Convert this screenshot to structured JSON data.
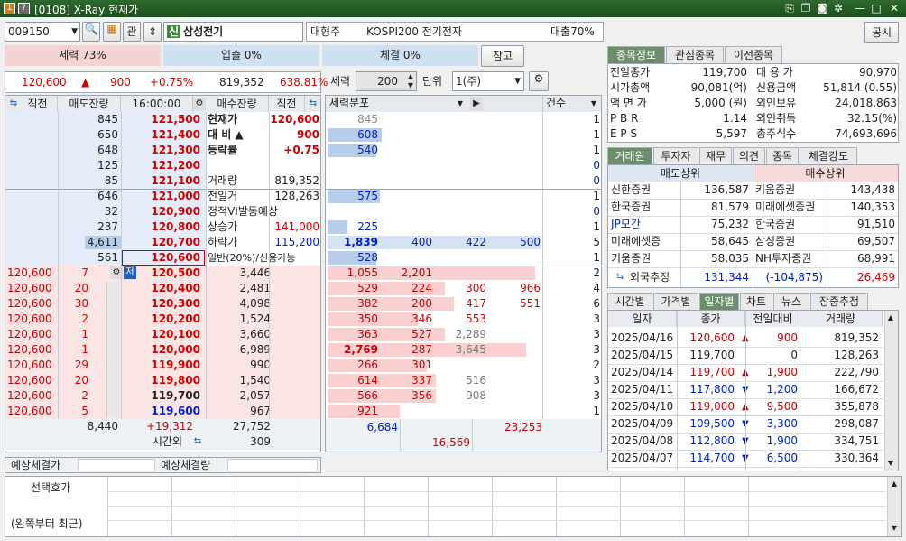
{
  "window": {
    "code_badge": "[0108]",
    "title": "X-Ray 현재가"
  },
  "stock": {
    "code": "009150",
    "name": "삼성전기",
    "badge": "신",
    "gwan": "관",
    "sector_label": "대형주",
    "index_label": "KOSPI200 전기전자",
    "loan": "대출70%",
    "public": "공시"
  },
  "strength": {
    "sell": "세력 73%",
    "inflow": "입출 0%",
    "exec": "체결 0%",
    "ref": "참고"
  },
  "price_bar": {
    "price": "120,600",
    "change": "900",
    "rate": "+0.75%",
    "volume": "819,352",
    "pct": "638.81%"
  },
  "controls": {
    "label1": "세력",
    "val1": "200",
    "label2": "단위",
    "unit": "1(주)",
    "dist": "세력분포",
    "count_label": "건수"
  },
  "ob_headers": [
    "직전",
    "매도잔량",
    "16:00:00",
    "매수잔량",
    "직전"
  ],
  "sell_rows": [
    {
      "qty": "845",
      "price": "121,500"
    },
    {
      "qty": "650",
      "price": "121,400"
    },
    {
      "qty": "648",
      "price": "121,300"
    },
    {
      "qty": "125",
      "price": "121,200"
    },
    {
      "qty": "85",
      "price": "121,100"
    },
    {
      "qty": "646",
      "price": "121,000"
    },
    {
      "qty": "32",
      "price": "120,900"
    },
    {
      "qty": "237",
      "price": "120,800"
    },
    {
      "qty": "4,611",
      "price": "120,700"
    },
    {
      "qty": "561",
      "price": "120,600"
    }
  ],
  "info_rows": [
    {
      "label": "현재가",
      "value": "120,600"
    },
    {
      "label": "대 비 ▲",
      "value": "900"
    },
    {
      "label": "등락률",
      "value": "+0.75"
    },
    {
      "label": "",
      "value": ""
    },
    {
      "label": "거래량",
      "value": "819,352"
    },
    {
      "label": "전일거",
      "value": "128,263"
    },
    {
      "label": "정적VI발동예상",
      "value": ""
    },
    {
      "label": "상승가",
      "value": "141,000"
    },
    {
      "label": "하락가",
      "value": "115,200"
    },
    {
      "label": "일반(20%)/신용가능",
      "value": ""
    }
  ],
  "buy_rows": [
    {
      "left": "120,600",
      "n": "7",
      "price": "120,500",
      "qty": "3,446"
    },
    {
      "left": "120,600",
      "n": "20",
      "price": "120,400",
      "qty": "2,481"
    },
    {
      "left": "120,600",
      "n": "30",
      "price": "120,300",
      "qty": "4,098"
    },
    {
      "left": "120,600",
      "n": "2",
      "price": "120,200",
      "qty": "1,524"
    },
    {
      "left": "120,600",
      "n": "1",
      "price": "120,100",
      "qty": "3,660"
    },
    {
      "left": "120,600",
      "n": "1",
      "price": "120,000",
      "qty": "6,989"
    },
    {
      "left": "120,600",
      "n": "29",
      "price": "119,900",
      "qty": "990"
    },
    {
      "left": "120,600",
      "n": "20",
      "price": "119,800",
      "qty": "1,540"
    },
    {
      "left": "120,600",
      "n": "2",
      "price": "119,700",
      "qty": "2,057"
    },
    {
      "left": "120,600",
      "n": "5",
      "price": "119,600",
      "qty": "967"
    }
  ],
  "ob_totals": {
    "sell": "8,440",
    "diff": "+19,312",
    "buy": "27,752",
    "after_label": "시간외",
    "after": "309"
  },
  "expected": {
    "price_label": "예상체결가",
    "qty_label": "예상체결량"
  },
  "dist_sell": [
    {
      "a": "845",
      "cnt": "1"
    },
    {
      "a": "608",
      "cnt": "1"
    },
    {
      "a": "540",
      "cnt": "1"
    },
    {
      "a": "",
      "cnt": "0"
    },
    {
      "a": "",
      "cnt": "0"
    },
    {
      "a": "575",
      "cnt": "1"
    },
    {
      "a": "",
      "cnt": "0"
    },
    {
      "a": "225",
      "cnt": "1"
    },
    {
      "a": "1,839",
      "b": "400",
      "c": "422",
      "d": "500",
      "cnt": "5"
    },
    {
      "a": "528",
      "cnt": "1"
    }
  ],
  "dist_buy": [
    {
      "a": "1,055",
      "b": "2,201",
      "cnt": "2"
    },
    {
      "a": "529",
      "b": "224",
      "c": "300",
      "d": "966",
      "cnt": "4"
    },
    {
      "a": "382",
      "b": "200",
      "c": "417",
      "d": "551",
      "cnt": "6"
    },
    {
      "a": "350",
      "b": "346",
      "c": "553",
      "cnt": "3"
    },
    {
      "a": "363",
      "b": "527",
      "c": "2,289",
      "cnt": "3"
    },
    {
      "a": "2,769",
      "b": "287",
      "c": "3,645",
      "cnt": "3"
    },
    {
      "a": "266",
      "b": "301",
      "cnt": "2"
    },
    {
      "a": "614",
      "b": "337",
      "c": "516",
      "cnt": "3"
    },
    {
      "a": "566",
      "b": "356",
      "c": "908",
      "cnt": "3"
    },
    {
      "a": "921",
      "cnt": "1"
    }
  ],
  "dist_totals": {
    "sell": "6,684",
    "buy": "23,253",
    "diff": "16,569"
  },
  "right_tabs1": [
    "종목정보",
    "관심종목",
    "이전종목"
  ],
  "info_grid": [
    {
      "l1": "전일종가",
      "v1": "119,700",
      "l2": "대 용 가",
      "v2": "90,970"
    },
    {
      "l1": "시가총액",
      "v1": "90,081(억)",
      "l2": "신용금액",
      "v2": "51,814  (0.55)"
    },
    {
      "l1": "액 면 가",
      "v1": "5,000 (원)",
      "l2": "외인보유",
      "v2": "24,018,863"
    },
    {
      "l1": "P B R",
      "v1": "1.14",
      "l2": "외인취득",
      "v2": "32.15(%)"
    },
    {
      "l1": "E P S",
      "v1": "5,597",
      "l2": "총주식수",
      "v2": "74,693,696"
    }
  ],
  "right_tabs2": [
    "거래원",
    "투자자",
    "재무",
    "의견",
    "종목",
    "체결강도"
  ],
  "broker_headers": {
    "sell": "매도상위",
    "buy": "매수상위"
  },
  "brokers": [
    {
      "s": "신한증권",
      "sv": "136,587",
      "b": "키움증권",
      "bv": "143,438"
    },
    {
      "s": "한국증권",
      "sv": "81,579",
      "b": "미래에셋증권",
      "bv": "140,353"
    },
    {
      "s": "JP모간",
      "sv": "75,232",
      "b": "한국증권",
      "bv": "91,510"
    },
    {
      "s": "미래에셋증",
      "sv": "58,645",
      "b": "삼성증권",
      "bv": "69,507"
    },
    {
      "s": "키움증권",
      "sv": "58,035",
      "b": "NH투자증권",
      "bv": "68,991"
    }
  ],
  "foreign": {
    "label": "외국추정",
    "sell": "131,344",
    "net": "(-104,875)",
    "buy": "26,469"
  },
  "right_tabs3": [
    "시간별",
    "가격별",
    "일자별",
    "차트",
    "뉴스",
    "장중추정"
  ],
  "daily_headers": [
    "일자",
    "종가",
    "전일대비",
    "거래량"
  ],
  "daily": [
    {
      "date": "2025/04/16",
      "close": "120,600",
      "dir": "▲",
      "chg": "900",
      "vol": "819,352",
      "color": "red"
    },
    {
      "date": "2025/04/15",
      "close": "119,700",
      "dir": "",
      "chg": "0",
      "vol": "128,263",
      "color": "black"
    },
    {
      "date": "2025/04/14",
      "close": "119,700",
      "dir": "▲",
      "chg": "1,900",
      "vol": "222,790",
      "color": "red"
    },
    {
      "date": "2025/04/11",
      "close": "117,800",
      "dir": "▼",
      "chg": "1,200",
      "vol": "166,672",
      "color": "blue"
    },
    {
      "date": "2025/04/10",
      "close": "119,000",
      "dir": "▲",
      "chg": "9,500",
      "vol": "355,878",
      "color": "red"
    },
    {
      "date": "2025/04/09",
      "close": "109,500",
      "dir": "▼",
      "chg": "3,300",
      "vol": "298,087",
      "color": "blue"
    },
    {
      "date": "2025/04/08",
      "close": "112,800",
      "dir": "▼",
      "chg": "1,900",
      "vol": "334,751",
      "color": "blue"
    },
    {
      "date": "2025/04/07",
      "close": "114,700",
      "dir": "▼",
      "chg": "6,500",
      "vol": "330,364",
      "color": "blue"
    }
  ],
  "bottom": {
    "select_label": "선택호가",
    "recent_label": "(왼쪽부터 최근)"
  }
}
